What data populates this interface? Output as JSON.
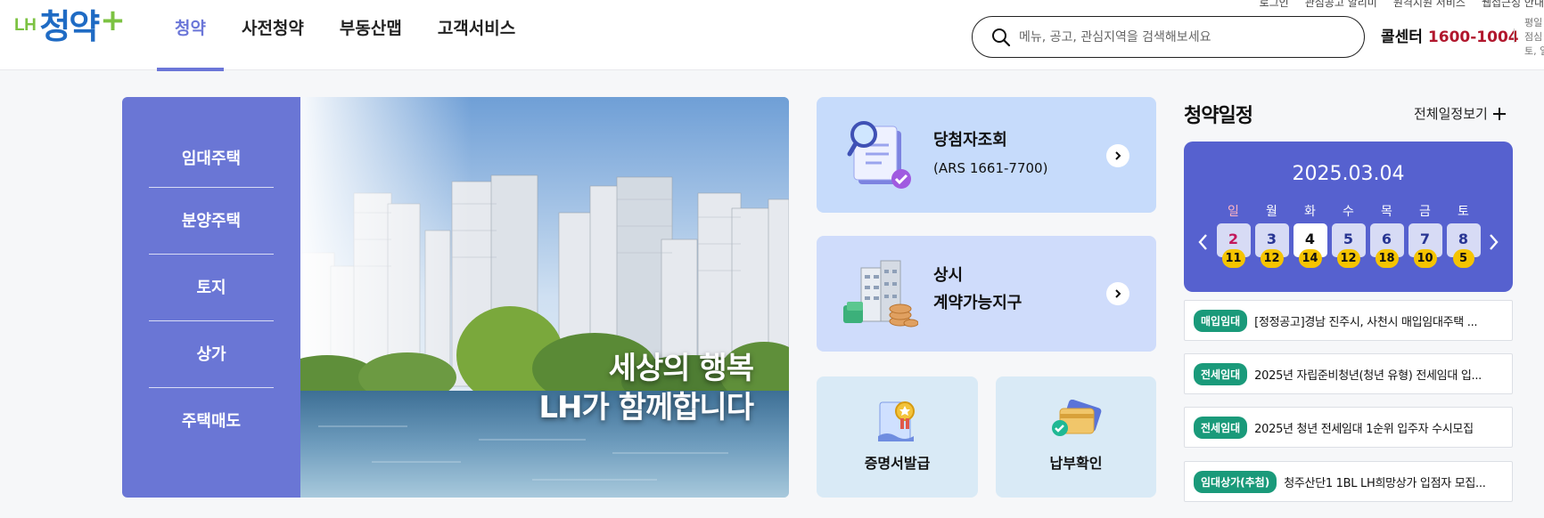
{
  "logo": {
    "prefix": "LH",
    "name": "청약",
    "plus": "+"
  },
  "gnb": [
    {
      "label": "청약",
      "active": true
    },
    {
      "label": "사전청약",
      "active": false
    },
    {
      "label": "부동산맵",
      "active": false
    },
    {
      "label": "고객서비스",
      "active": false
    }
  ],
  "util": [
    "로그인",
    "관심공고 알리미",
    "원격지원 서비스",
    "웹접근성 안내"
  ],
  "search": {
    "placeholder": "메뉴, 공고, 관심지역을 검색해보세요"
  },
  "callcenter": {
    "label": "콜센터",
    "number": "1600-1004",
    "hours": [
      "평일",
      "점심",
      "토, 일"
    ]
  },
  "category_menu": [
    "임대주택",
    "분양주택",
    "토지",
    "상가",
    "주택매도"
  ],
  "hero": {
    "line1": "세상의 행복",
    "line2": "LH가 함께합니다"
  },
  "quick": {
    "winner": {
      "title": "당첨자조회",
      "sub": "(ARS 1661-7700)"
    },
    "contract": {
      "title1": "상시",
      "title2": "계약가능지구"
    },
    "cert": {
      "label": "증명서발급"
    },
    "payment": {
      "label": "납부확인"
    }
  },
  "schedule": {
    "title": "청약일정",
    "more": "전체일정보기",
    "date": "2025.03.04",
    "days": [
      {
        "dow": "일",
        "date": "2",
        "count": "11",
        "type": "sun"
      },
      {
        "dow": "월",
        "date": "3",
        "count": "12",
        "type": ""
      },
      {
        "dow": "화",
        "date": "4",
        "count": "14",
        "type": "today"
      },
      {
        "dow": "수",
        "date": "5",
        "count": "12",
        "type": ""
      },
      {
        "dow": "목",
        "date": "6",
        "count": "18",
        "type": ""
      },
      {
        "dow": "금",
        "date": "7",
        "count": "10",
        "type": ""
      },
      {
        "dow": "토",
        "date": "8",
        "count": "5",
        "type": "sat"
      }
    ]
  },
  "notices": [
    {
      "tag": "매입임대",
      "text": "[정정공고]경남 진주시, 사천시 매입임대주택 ..."
    },
    {
      "tag": "전세임대",
      "text": "2025년 자립준비청년(청년 유형) 전세임대 입..."
    },
    {
      "tag": "전세임대",
      "text": "2025년 청년 전세임대 1순위 입주자 수시모집"
    },
    {
      "tag": "임대상가(추첨)",
      "text": "청주산단1 1BL LH희망상가 입점자 모집..."
    }
  ],
  "colors": {
    "brand": "#6a76d5",
    "calendar": "#5661cf",
    "badge": "#f5c400",
    "tag": "#1a9a7a",
    "callnum": "#b1172d"
  }
}
